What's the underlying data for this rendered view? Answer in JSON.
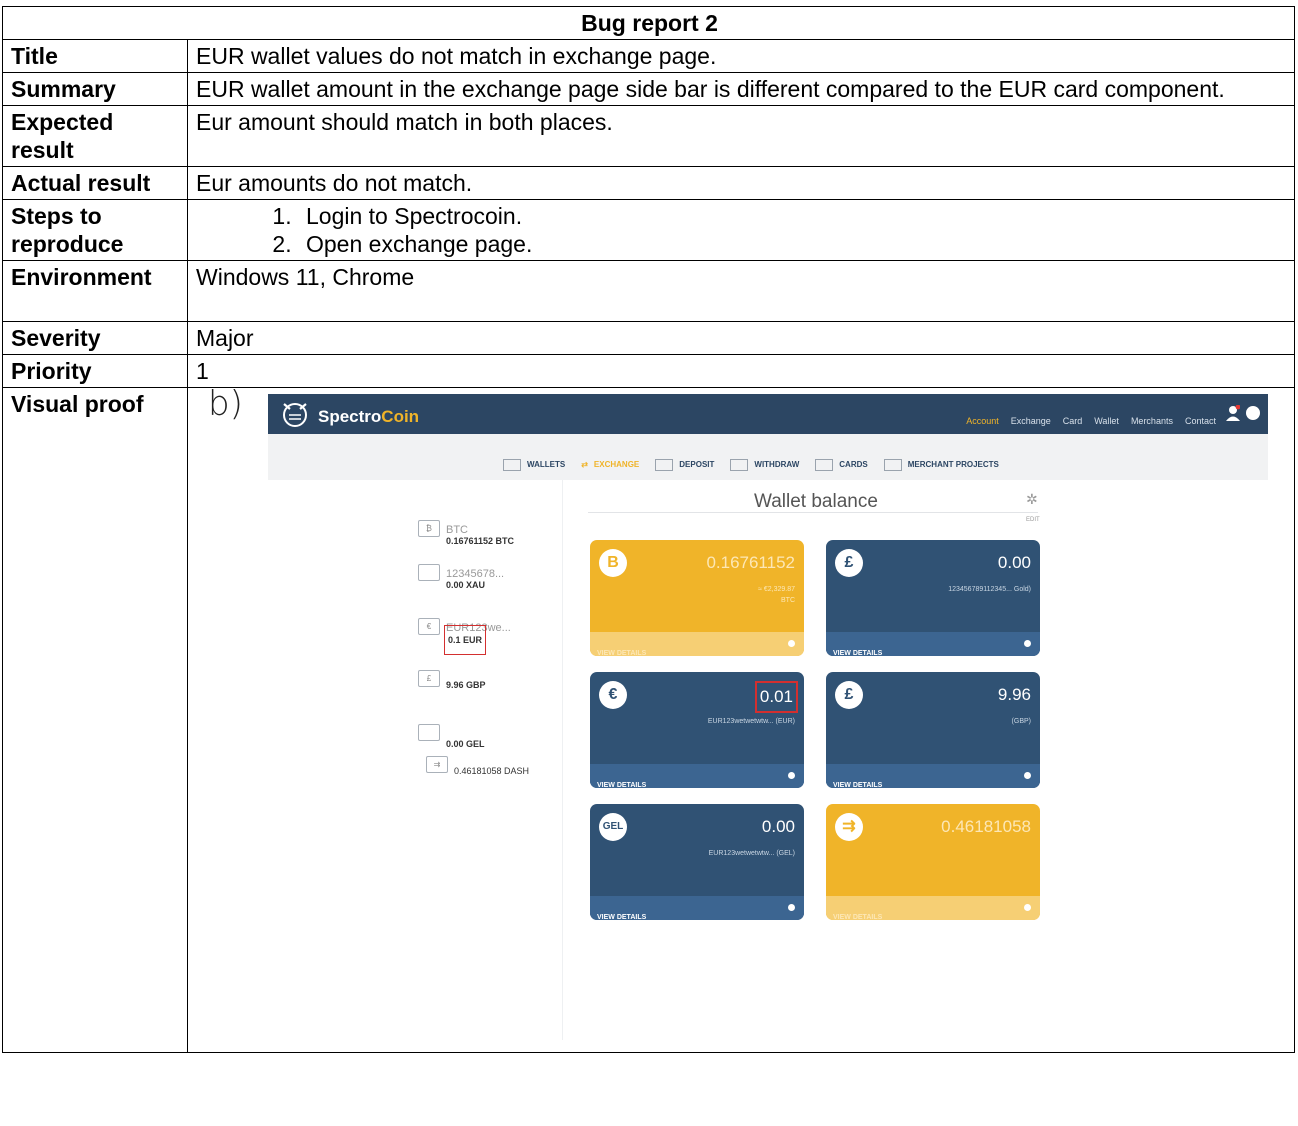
{
  "report": {
    "heading": "Bug report 2",
    "rows": [
      {
        "label": "Title",
        "value": "EUR wallet values do not match in exchange page."
      },
      {
        "label": "Summary",
        "value": "EUR wallet amount in the exchange page side bar is different compared to the EUR card component."
      },
      {
        "label": "Expected result",
        "value": "Eur amount should match in both places."
      },
      {
        "label": "Actual result",
        "value": "Eur amounts do not match."
      }
    ],
    "steps_label": "Steps to reproduce",
    "steps": [
      "Login to Spectrocoin.",
      "Open exchange page."
    ],
    "rows2": [
      {
        "label": "Environment",
        "value": "Windows 11, Chrome"
      },
      {
        "label": "Severity",
        "value": "Major"
      },
      {
        "label": "Priority",
        "value": "1"
      }
    ],
    "proof_label": "Visual proof"
  },
  "proof": {
    "label": "b)",
    "logo_a": "Spectro",
    "logo_b": "Coin",
    "nav": [
      "Account",
      "Exchange",
      "Card",
      "Wallet",
      "Merchants",
      "Contact"
    ],
    "subnav": [
      "WALLETS",
      "EXCHANGE",
      "DEPOSIT",
      "WITHDRAW",
      "CARDS",
      "MERCHANT PROJECTS"
    ],
    "title": "Wallet balance",
    "edit": "EDIT",
    "sidebar": [
      {
        "name": "BTC",
        "value": "0.16761152 BTC",
        "icon": "₿"
      },
      {
        "name": "12345678...",
        "value": "0.00 XAU",
        "icon": ""
      },
      {
        "name": "EUR123we...",
        "value": "0.1 EUR",
        "icon": "€"
      },
      {
        "name": "",
        "value": "9.96 GBP",
        "icon": "£"
      },
      {
        "name": "",
        "value": "0.00 GEL",
        "icon": ""
      },
      {
        "name": "",
        "value": "0.46181058 DASH",
        "icon": "⇉"
      }
    ],
    "cards": [
      {
        "icon": "B",
        "amount": "0.16761152",
        "sub1": "≈ €2,329.87",
        "sub2": "BTC",
        "footer": "VIEW DETAILS"
      },
      {
        "icon": "£",
        "amount": "0.00",
        "sub1": "123456789112345... Gold)",
        "sub2": "",
        "footer": "VIEW DETAILS"
      },
      {
        "icon": "€",
        "amount": "0.01",
        "sub1": "EUR123wetwetwtw... (EUR)",
        "sub2": "",
        "footer": "VIEW DETAILS"
      },
      {
        "icon": "£",
        "amount": "9.96",
        "sub1": "(GBP)",
        "sub2": "",
        "footer": "VIEW DETAILS"
      },
      {
        "icon": "GEL",
        "amount": "0.00",
        "sub1": "EUR123wetwetwtw... (GEL)",
        "sub2": "",
        "footer": "VIEW DETAILS"
      },
      {
        "icon": "⇉",
        "amount": "0.46181058",
        "sub1": "",
        "sub2": "",
        "footer": "VIEW DETAILS"
      }
    ],
    "colors": {
      "navy": "#2c4663",
      "card_blue": "#305274",
      "gold": "#f0b429",
      "highlight": "#d32f2f"
    }
  }
}
